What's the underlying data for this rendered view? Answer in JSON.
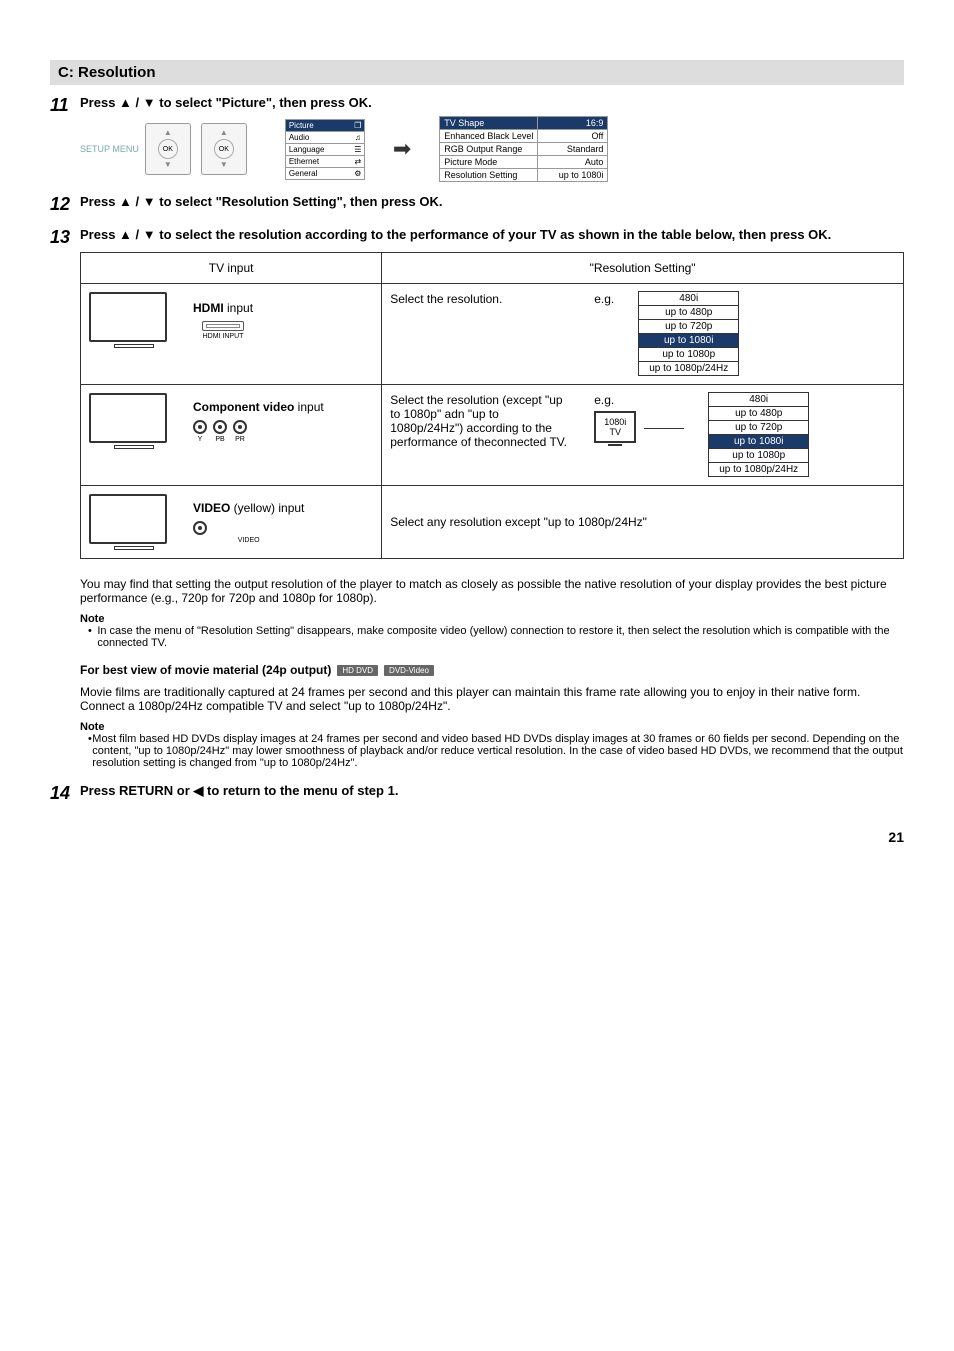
{
  "section_header": "C: Resolution",
  "steps": {
    "s11": {
      "num": "11",
      "title_pre": "Press ",
      "title_mid": " / ",
      "title_post": " to select \"Picture\", then press OK.",
      "setup_label": "SETUP MENU",
      "remote_ok": "OK",
      "menu_items": [
        {
          "label": "Picture",
          "icon": "❐",
          "sel": true
        },
        {
          "label": "Audio",
          "icon": "♫"
        },
        {
          "label": "Language",
          "icon": "☰"
        },
        {
          "label": "Ethernet",
          "icon": "⇄"
        },
        {
          "label": "General",
          "icon": "⚙"
        }
      ],
      "settings": [
        {
          "label": "TV Shape",
          "val": "16:9",
          "sel": true
        },
        {
          "label": "Enhanced Black Level",
          "val": "Off"
        },
        {
          "label": "RGB Output Range",
          "val": "Standard"
        },
        {
          "label": "Picture Mode",
          "val": "Auto"
        },
        {
          "label": "Resolution Setting",
          "val": "up to 1080i"
        }
      ]
    },
    "s12": {
      "num": "12",
      "title_pre": "Press ",
      "title_mid": " / ",
      "title_post": " to select \"Resolution Setting\", then press OK."
    },
    "s13": {
      "num": "13",
      "title_pre": "Press ",
      "title_mid": " / ",
      "title_post": " to select the resolution according to the performance of your TV as shown in the table below, then press OK."
    },
    "s14": {
      "num": "14",
      "title_pre": "Press RETURN or ",
      "title_post": " to return to the menu of step 1."
    }
  },
  "table": {
    "head1": "TV input",
    "head2": "\"Resolution Setting\"",
    "row_hdmi": {
      "label_bold": "HDMI",
      "label_rest": " input",
      "caption": "HDMI INPUT",
      "desc": "Select the resolution.",
      "eg": "e.g.",
      "opts": [
        "480i",
        "up to 480p",
        "up to 720p",
        "up to 1080i",
        "up to 1080p",
        "up to 1080p/24Hz"
      ],
      "sel_index": 3
    },
    "row_component": {
      "label_bold": "Component video",
      "label_rest": " input",
      "labels": [
        "Y",
        "PB",
        "PR"
      ],
      "desc": "Select the resolution (except \"up to 1080p\" adn \"up to 1080p/24Hz\") according to the performance of theconnected TV.",
      "eg": "e.g.",
      "tv_line1": "1080i",
      "tv_line2": "TV",
      "opts": [
        "480i",
        "up to 480p",
        "up to 720p",
        "up to 1080i",
        "up to 1080p",
        "up to 1080p/24Hz"
      ],
      "sel_index": 3
    },
    "row_video": {
      "label_bold": "VIDEO",
      "label_rest": " (yellow) input",
      "caption": "VIDEO",
      "desc": "Select any resolution except \"up to 1080p/24Hz\""
    }
  },
  "fine_print": "You may find that setting the output resolution of the player to match as closely as possible the native resolution of your display provides the best picture performance (e.g., 720p for 720p and 1080p for 1080p).",
  "note1_head": "Note",
  "note1_body": "In case the menu of \"Resolution Setting\" disappears, make composite video (yellow) connection to restore it, then select the resolution which is compatible with the connected TV.",
  "subhead": "For best view of movie material (24p output)",
  "badge1": "HD DVD",
  "badge2": "DVD-Video",
  "para1": "Movie films are traditionally captured at 24 frames per second and this player can maintain this frame rate allowing you to enjoy in their native form. Connect a 1080p/24Hz compatible TV and select \"up to 1080p/24Hz\".",
  "note2_head": "Note",
  "note2_body": "Most film based HD DVDs display images at 24 frames per second and video based HD DVDs display images at 30 frames or 60 fields per second. Depending on the content, \"up to 1080p/24Hz\" may lower smoothness of playback and/or reduce vertical resolution. In the case of video based HD DVDs, we recommend that the output resolution setting is changed from \"up to 1080p/24Hz\".",
  "page": "21",
  "glyphs": {
    "up": "▲",
    "down": "▼",
    "left": "◀",
    "arrow_right": "➡"
  }
}
